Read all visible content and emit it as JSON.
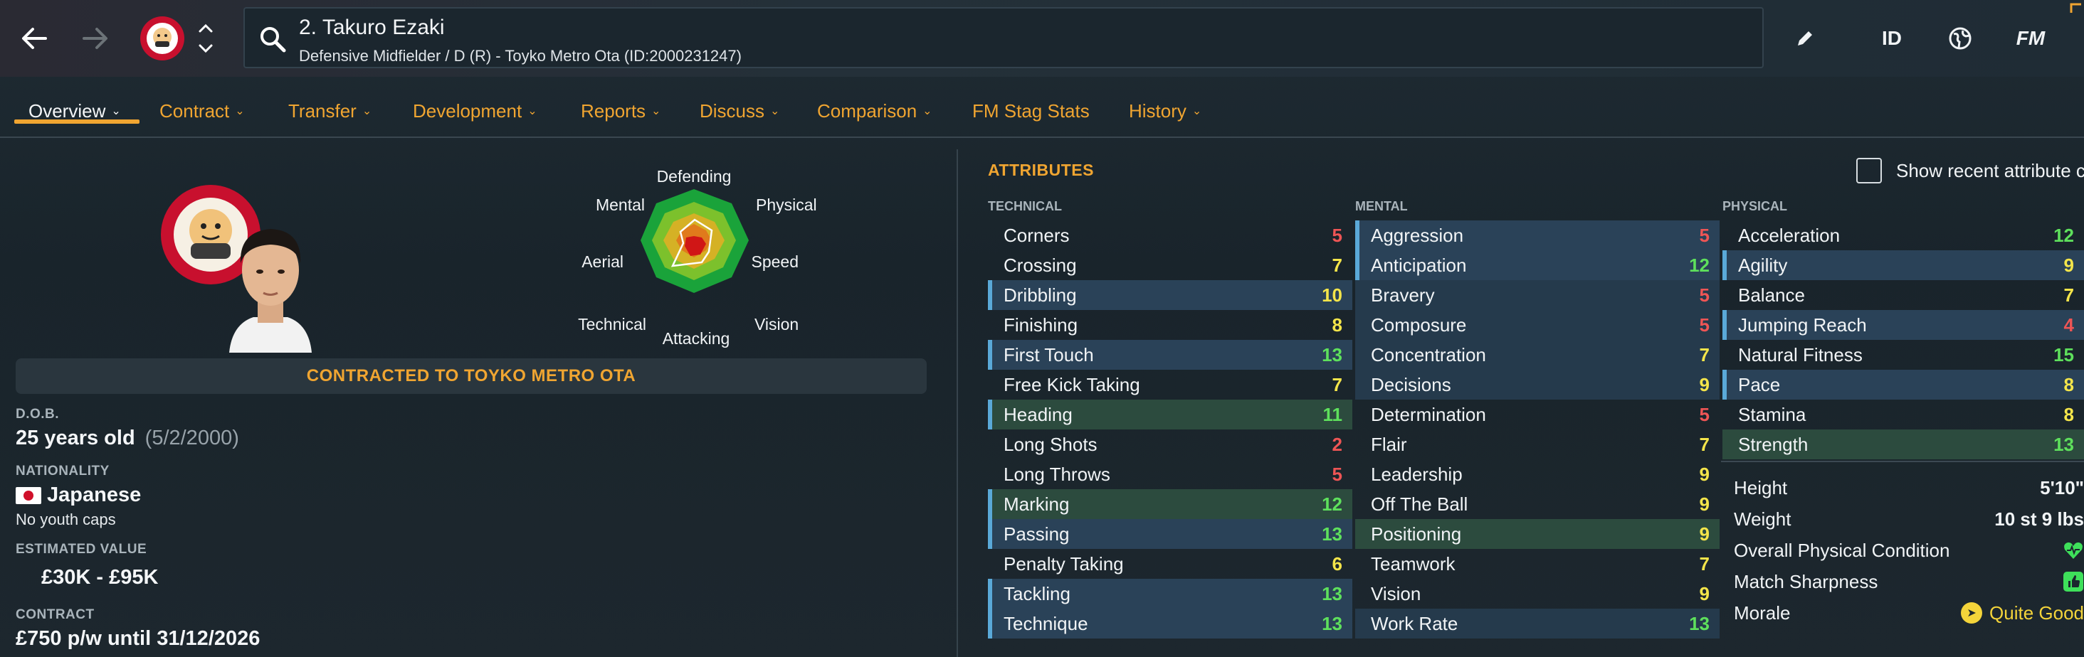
{
  "header": {
    "title": "2. Takuro Ezaki",
    "subtitle": "Defensive Midfielder / D (R) - Toyko Metro Ota (ID:2000231247)",
    "id_label": "ID",
    "fm_label": "FM"
  },
  "tabs": [
    {
      "label": "Overview",
      "has_menu": true,
      "active": true
    },
    {
      "label": "Contract",
      "has_menu": true
    },
    {
      "label": "Transfer",
      "has_menu": true
    },
    {
      "label": "Development",
      "has_menu": true
    },
    {
      "label": "Reports",
      "has_menu": true
    },
    {
      "label": "Discuss",
      "has_menu": true
    },
    {
      "label": "Comparison",
      "has_menu": true
    },
    {
      "label": "FM Stag Stats",
      "has_menu": false
    },
    {
      "label": "History",
      "has_menu": true
    }
  ],
  "radar": {
    "labels": {
      "defending": "Defending",
      "physical": "Physical",
      "speed": "Speed",
      "vision": "Vision",
      "attacking": "Attacking",
      "technical": "Technical",
      "aerial": "Aerial",
      "mental": "Mental"
    }
  },
  "player": {
    "contract_banner": "CONTRACTED TO TOYKO METRO OTA",
    "dob_label": "D.O.B.",
    "age": "25 years old",
    "dob": "(5/2/2000)",
    "nationality_label": "NATIONALITY",
    "nationality": "Japanese",
    "caps": "No youth caps",
    "value_label": "ESTIMATED VALUE",
    "value": "£30K - £95K",
    "contract_label": "CONTRACT",
    "contract": "£750 p/w until 31/12/2026"
  },
  "attributes": {
    "title": "ATTRIBUTES",
    "recent_label": "Show recent attribute changes",
    "technical_title": "TECHNICAL",
    "mental_title": "MENTAL",
    "physical_title": "PHYSICAL",
    "technical": [
      {
        "name": "Corners",
        "value": "5"
      },
      {
        "name": "Crossing",
        "value": "7"
      },
      {
        "name": "Dribbling",
        "value": "10"
      },
      {
        "name": "Finishing",
        "value": "8"
      },
      {
        "name": "First Touch",
        "value": "13"
      },
      {
        "name": "Free Kick Taking",
        "value": "7"
      },
      {
        "name": "Heading",
        "value": "11"
      },
      {
        "name": "Long Shots",
        "value": "2"
      },
      {
        "name": "Long Throws",
        "value": "5"
      },
      {
        "name": "Marking",
        "value": "12"
      },
      {
        "name": "Passing",
        "value": "13"
      },
      {
        "name": "Penalty Taking",
        "value": "6"
      },
      {
        "name": "Tackling",
        "value": "13"
      },
      {
        "name": "Technique",
        "value": "13"
      }
    ],
    "mental": [
      {
        "name": "Aggression",
        "value": "5"
      },
      {
        "name": "Anticipation",
        "value": "12"
      },
      {
        "name": "Bravery",
        "value": "5"
      },
      {
        "name": "Composure",
        "value": "5"
      },
      {
        "name": "Concentration",
        "value": "7"
      },
      {
        "name": "Decisions",
        "value": "9"
      },
      {
        "name": "Determination",
        "value": "5"
      },
      {
        "name": "Flair",
        "value": "7"
      },
      {
        "name": "Leadership",
        "value": "9"
      },
      {
        "name": "Off The Ball",
        "value": "9"
      },
      {
        "name": "Positioning",
        "value": "9"
      },
      {
        "name": "Teamwork",
        "value": "7"
      },
      {
        "name": "Vision",
        "value": "9"
      },
      {
        "name": "Work Rate",
        "value": "13"
      }
    ],
    "physical": [
      {
        "name": "Acceleration",
        "value": "12"
      },
      {
        "name": "Agility",
        "value": "9"
      },
      {
        "name": "Balance",
        "value": "7"
      },
      {
        "name": "Jumping Reach",
        "value": "4"
      },
      {
        "name": "Natural Fitness",
        "value": "15"
      },
      {
        "name": "Pace",
        "value": "8"
      },
      {
        "name": "Stamina",
        "value": "8"
      },
      {
        "name": "Strength",
        "value": "13"
      }
    ],
    "physical_info": {
      "height_label": "Height",
      "height": "5'10\"",
      "weight_label": "Weight",
      "weight": "10 st 9 lbs",
      "condition_label": "Overall Physical Condition",
      "sharpness_label": "Match Sharpness",
      "morale_label": "Morale",
      "morale": "Quite Good"
    }
  },
  "colors": {
    "accent": "#f0a531",
    "low": "#ee5555",
    "mid": "#f4e54a",
    "high": "#5ee05c",
    "row_alt": "#253a4c",
    "row_green": "#2c4b3e",
    "row_marker": "#5aa9d8"
  }
}
